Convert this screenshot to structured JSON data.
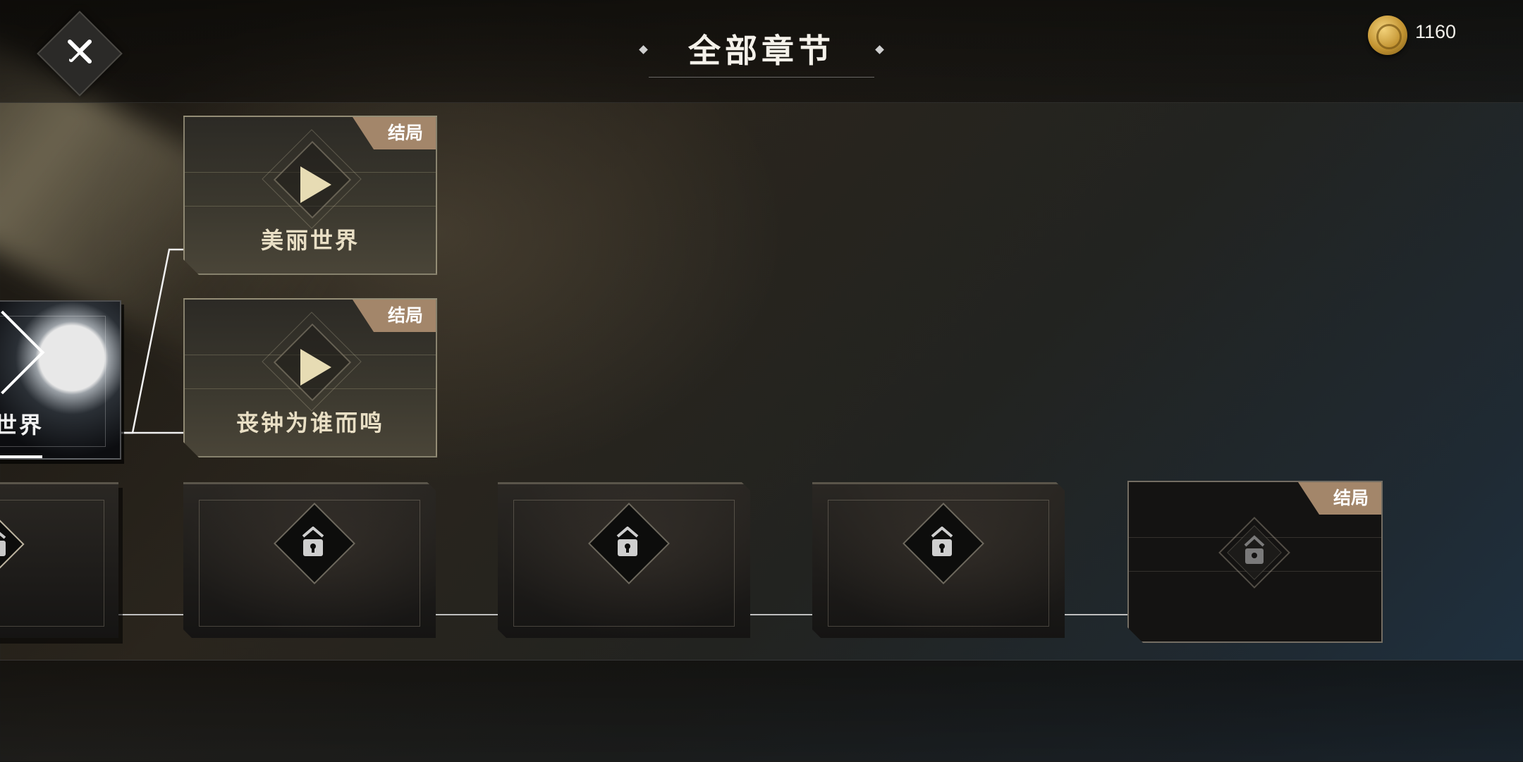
{
  "header": {
    "title": "全部章节",
    "coins": "1160"
  },
  "chapters": {
    "branch_top": {
      "title": "美丽世界",
      "badge": "结局"
    },
    "branch_bottom": {
      "title": "丧钟为谁而鸣",
      "badge": "结局"
    },
    "current": {
      "title_partial": "世界",
      "progress": 0.4
    },
    "locked_end_badge": "结局"
  },
  "colors": {
    "badge": "#a3866a",
    "coin": "#c39432",
    "accent_text": "#e9dfc5"
  }
}
